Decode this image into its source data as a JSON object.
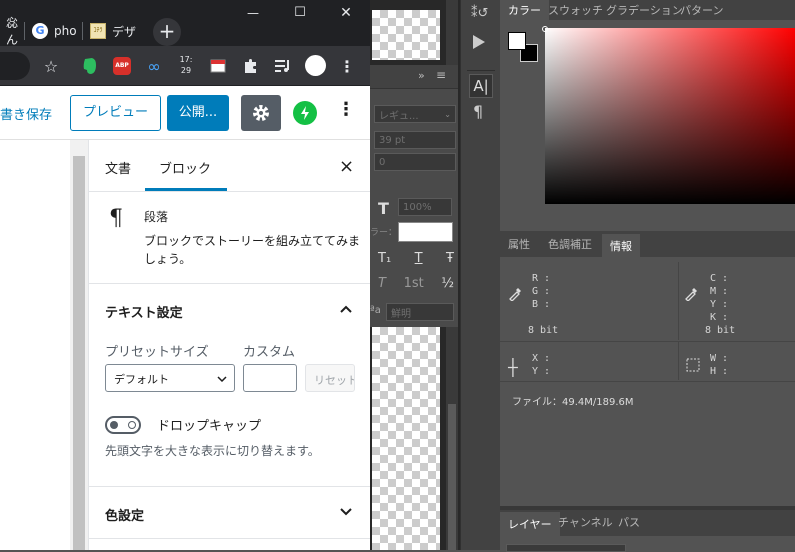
{
  "chrome": {
    "tabs": [
      {
        "label": "惢ん"
      },
      {
        "label": "pho"
      },
      {
        "label": "デザ"
      }
    ],
    "new_tab_label": "+",
    "window_controls": {
      "minimize": "—",
      "maximize": "☐",
      "close": "✕"
    },
    "toolbar": {
      "abp_label": "ABP",
      "counter_top": "17:",
      "counter_bottom": "29"
    }
  },
  "wp": {
    "save_draft": "書き保存",
    "preview": "プレビュー",
    "publish": "公開...",
    "sidebar": {
      "tabs": [
        "文書",
        "ブロック"
      ],
      "active_tab": "ブロック",
      "close": "×",
      "block_name": "段落",
      "block_desc": "ブロックでストーリーを組み立ててみましょう。",
      "text_settings": "テキスト設定",
      "preset_size_label": "プリセットサイズ",
      "custom_label": "カスタム",
      "preset_value": "デフォルト",
      "reset_label": "リセット",
      "dropcap_label": "ドロップキャップ",
      "dropcap_help": "先頭文字を大きな表示に切り替えます。",
      "color_settings": "色設定"
    }
  },
  "ps": {
    "char_panel": {
      "font_style": "レギュ...",
      "size": "39 pt",
      "leading": "0",
      "scale": "100%",
      "color_label": "ラー：",
      "antialias": "鮮明",
      "typo_buttons": [
        "T₁",
        "T",
        "Ŧ",
        "T",
        "1st",
        "½"
      ]
    },
    "color_panel": {
      "tabs": [
        "カラー",
        "スウォッチ",
        "グラデーション",
        "パターン"
      ],
      "active_tab": "カラー",
      "foreground": "#ffffff",
      "background": "#000000",
      "hue": "#ff0000"
    },
    "info_panel": {
      "tabs": [
        "属性",
        "色調補正",
        "情報"
      ],
      "active_tab": "情報",
      "rgb": [
        "R :",
        "G :",
        "B :"
      ],
      "cmyk": [
        "C :",
        "M :",
        "Y :",
        "K :"
      ],
      "bit_left": "8 bit",
      "bit_right": "8 bit",
      "xy": [
        "X :",
        "Y :"
      ],
      "wh": [
        "W :",
        "H :"
      ],
      "file": "ファイル：49.4M/189.6M"
    },
    "layers_panel": {
      "tabs": [
        "レイヤー",
        "チャンネル",
        "パス"
      ],
      "active_tab": "レイヤー"
    }
  },
  "colors": {
    "wp_blue": "#007cba",
    "ps_bg": "#535353",
    "chrome_dark": "#202124"
  }
}
